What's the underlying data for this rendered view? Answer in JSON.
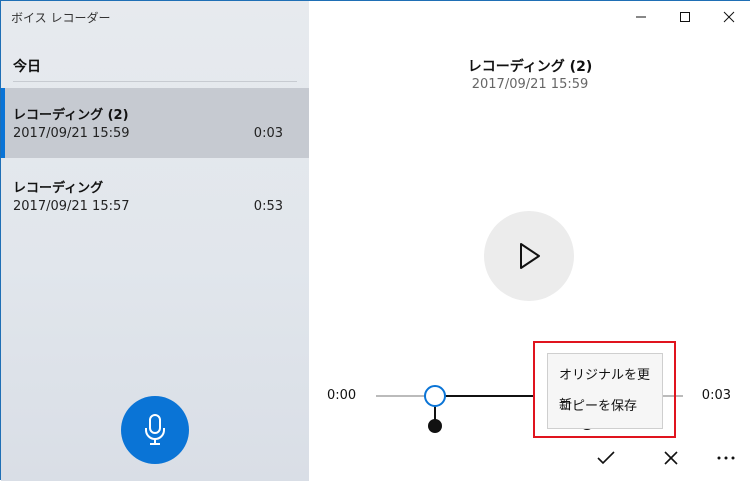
{
  "app": {
    "title": "ボイス レコーダー"
  },
  "list": {
    "section_header": "今日",
    "items": [
      {
        "title": "レコーディング (2)",
        "date": "2017/09/21 15:59",
        "duration": "0:03",
        "selected": true
      },
      {
        "title": "レコーディング",
        "date": "2017/09/21 15:57",
        "duration": "0:53",
        "selected": false
      }
    ]
  },
  "detail": {
    "title": "レコーディング (2)",
    "date": "2017/09/21 15:59",
    "time_start": "0:00",
    "time_end": "0:03"
  },
  "trim_menu": {
    "items": [
      "オリジナルを更新",
      "コピーを保存"
    ]
  },
  "icons": {
    "minimize": "minimize-icon",
    "maximize": "maximize-icon",
    "close": "close-icon",
    "record": "microphone-icon",
    "play": "play-icon",
    "confirm": "checkmark-icon",
    "cancel": "x-icon",
    "more": "more-icon"
  },
  "colors": {
    "accent": "#0a74d6",
    "highlight": "#e0141e"
  }
}
